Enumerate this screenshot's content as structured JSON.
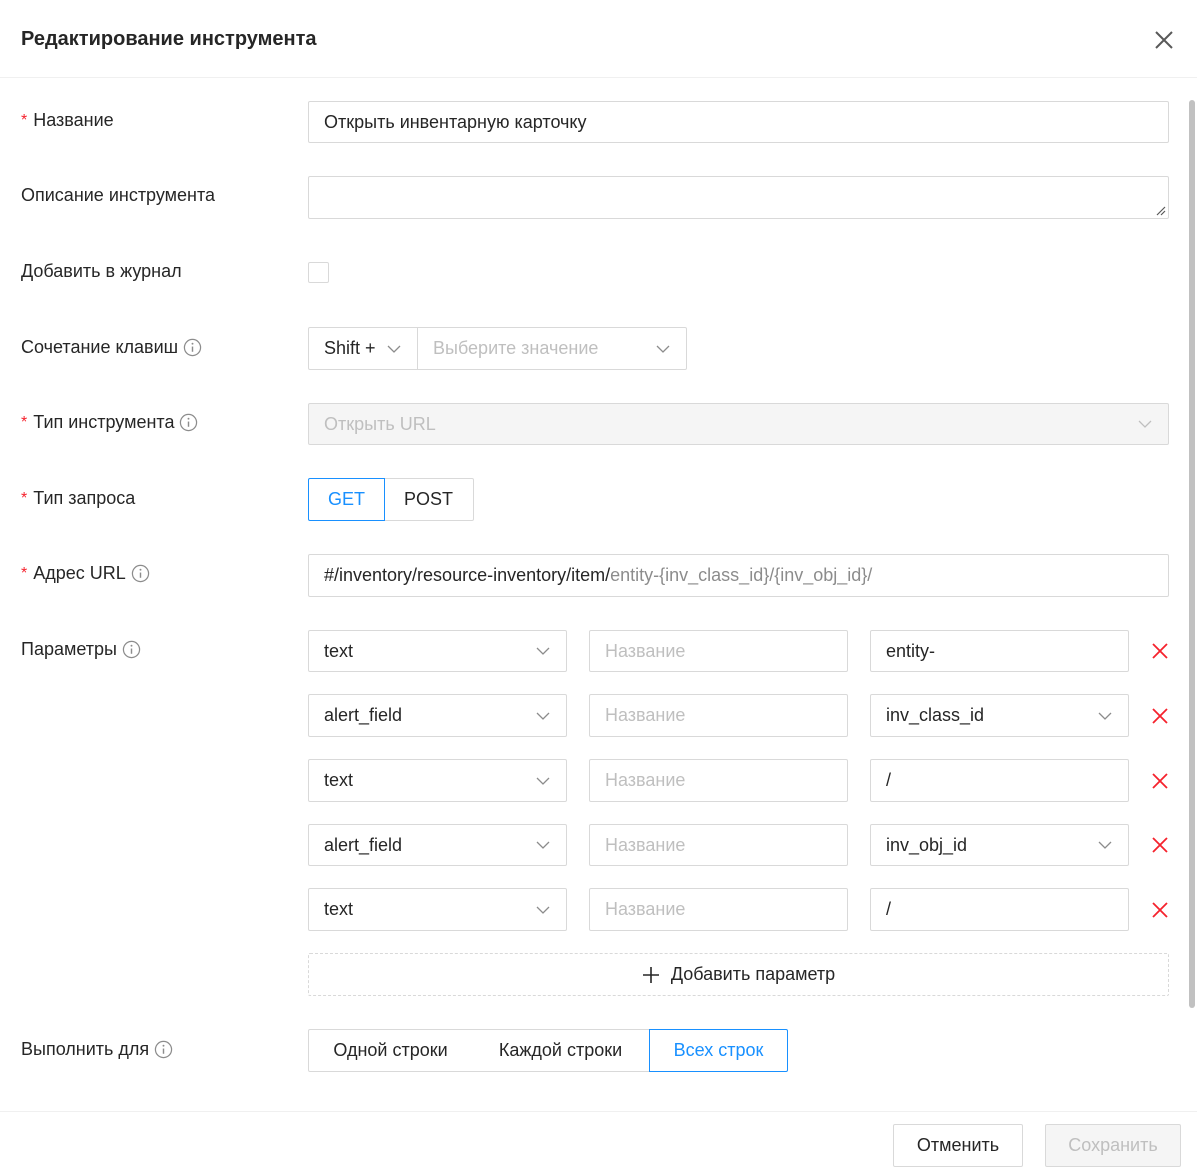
{
  "modal": {
    "title": "Редактирование инструмента"
  },
  "fields": {
    "name": {
      "label": "Название",
      "value": "Открыть инвентарную карточку"
    },
    "description": {
      "label": "Описание инструмента",
      "value": ""
    },
    "add_to_log": {
      "label": "Добавить в журнал",
      "checked": false
    },
    "hotkey": {
      "label": "Сочетание клавиш",
      "modifier": "Shift +",
      "key_placeholder": "Выберите значение"
    },
    "tool_type": {
      "label": "Тип инструмента",
      "value": "Открыть URL"
    },
    "request_type": {
      "label": "Тип запроса",
      "options": [
        "GET",
        "POST"
      ],
      "selected": "GET"
    },
    "url": {
      "label": "Адрес URL",
      "prefix": "#/inventory/resource-inventory/item/",
      "suffix": "entity-{inv_class_id}/{inv_obj_id}/"
    },
    "parameters": {
      "label": "Параметры",
      "name_placeholder": "Название",
      "rows": [
        {
          "type": "text",
          "value": "entity-"
        },
        {
          "type": "alert_field",
          "value": "inv_class_id"
        },
        {
          "type": "text",
          "value": "/"
        },
        {
          "type": "alert_field",
          "value": "inv_obj_id"
        },
        {
          "type": "text",
          "value": "/"
        }
      ],
      "add_label": "Добавить параметр"
    },
    "execute_for": {
      "label": "Выполнить для",
      "options": [
        "Одной строки",
        "Каждой строки",
        "Всех строк"
      ],
      "selected": "Всех строк"
    }
  },
  "footer": {
    "cancel_label": "Отменить",
    "save_label": "Сохранить"
  },
  "colors": {
    "accent": "#1890ff",
    "required": "#f5222d",
    "delete": "#f5222d",
    "border": "#d9d9d9",
    "disabled_bg": "#f5f5f5"
  }
}
